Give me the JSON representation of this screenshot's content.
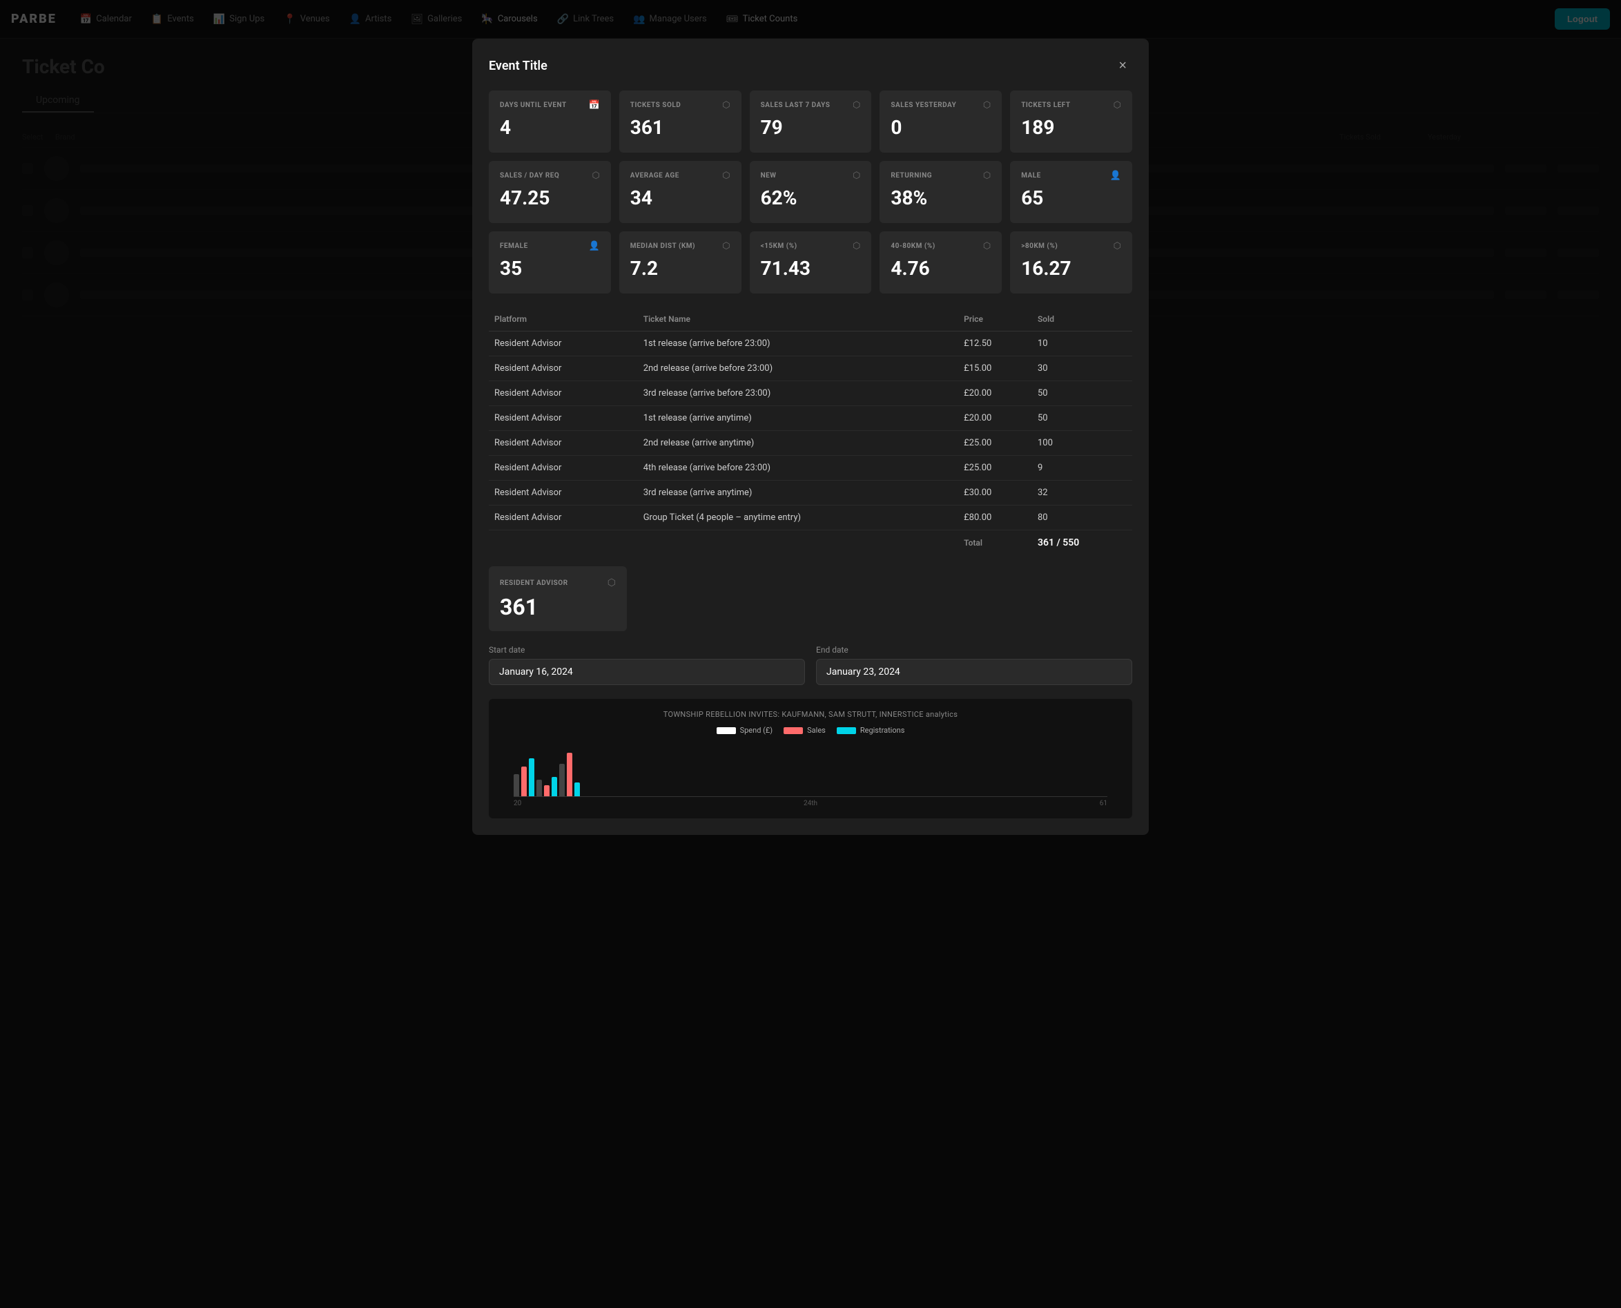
{
  "app": {
    "logo": "PARBE",
    "logout_label": "Logout"
  },
  "nav": {
    "items": [
      {
        "id": "calendar",
        "label": "Calendar",
        "icon": "📅"
      },
      {
        "id": "events",
        "label": "Events",
        "icon": "📋"
      },
      {
        "id": "signups",
        "label": "Sign Ups",
        "icon": "📊"
      },
      {
        "id": "venues",
        "label": "Venues",
        "icon": "📍"
      },
      {
        "id": "artists",
        "label": "Artists",
        "icon": "👤"
      },
      {
        "id": "galleries",
        "label": "Galleries",
        "icon": "🖼"
      },
      {
        "id": "carousels",
        "label": "Carousels",
        "icon": "🎠"
      },
      {
        "id": "linktrees",
        "label": "Link Trees",
        "icon": "🔗"
      },
      {
        "id": "manageusers",
        "label": "Manage Users",
        "icon": "👥"
      },
      {
        "id": "ticketcounts",
        "label": "Ticket Counts",
        "icon": "🎟"
      }
    ]
  },
  "page": {
    "title": "Ticket Co",
    "tabs": [
      {
        "id": "upcoming",
        "label": "Upcoming",
        "active": true
      }
    ],
    "table_columns": [
      "Select",
      "Brand",
      "Tickets Sold",
      "Yesterday"
    ]
  },
  "modal": {
    "title": "Event Title",
    "close_label": "×",
    "stats_row1": [
      {
        "id": "days_until",
        "label": "DAYS UNTIL EVENT",
        "value": "4",
        "icon": "📅"
      },
      {
        "id": "tickets_sold",
        "label": "TICKETS SOLD",
        "value": "361",
        "icon": "🎟"
      },
      {
        "id": "sales_last7",
        "label": "SALES LAST 7 DAYS",
        "value": "79",
        "icon": "🎟"
      },
      {
        "id": "sales_yesterday",
        "label": "SALES YESTERDAY",
        "value": "0",
        "icon": "🎟"
      },
      {
        "id": "tickets_left",
        "label": "TICKETS LEFT",
        "value": "189",
        "icon": "🎟"
      }
    ],
    "stats_row2": [
      {
        "id": "sales_day_req",
        "label": "SALES / DAY REQ",
        "value": "47.25",
        "icon": "🎟"
      },
      {
        "id": "avg_age",
        "label": "AVERAGE AGE",
        "value": "34",
        "icon": "🎟"
      },
      {
        "id": "new",
        "label": "NEW",
        "value": "62%",
        "icon": "🎟"
      },
      {
        "id": "returning",
        "label": "RETURNING",
        "value": "38%",
        "icon": "🎟"
      },
      {
        "id": "male",
        "label": "MALE",
        "value": "65",
        "icon": "👤"
      }
    ],
    "stats_row3": [
      {
        "id": "female",
        "label": "FEMALE",
        "value": "35",
        "icon": "👤"
      },
      {
        "id": "median_dist",
        "label": "MEDIAN DIST (KM)",
        "value": "7.2",
        "icon": "🎟"
      },
      {
        "id": "lt15km",
        "label": "<15KM (%)",
        "value": "71.43",
        "icon": "🎟"
      },
      {
        "id": "km40_80",
        "label": "40-80KM (%)",
        "value": "4.76",
        "icon": "🎟"
      },
      {
        "id": "gt80km",
        "label": ">80KM (%)",
        "value": "16.27",
        "icon": "🎟"
      }
    ],
    "table": {
      "columns": [
        "Platform",
        "Ticket Name",
        "Price",
        "Sold"
      ],
      "rows": [
        {
          "platform": "Resident Advisor",
          "ticket_name": "1st release (arrive before 23:00)",
          "price": "£12.50",
          "sold": "10"
        },
        {
          "platform": "Resident Advisor",
          "ticket_name": "2nd release (arrive before 23:00)",
          "price": "£15.00",
          "sold": "30"
        },
        {
          "platform": "Resident Advisor",
          "ticket_name": "3rd release (arrive before 23:00)",
          "price": "£20.00",
          "sold": "50"
        },
        {
          "platform": "Resident Advisor",
          "ticket_name": "1st release (arrive anytime)",
          "price": "£20.00",
          "sold": "50"
        },
        {
          "platform": "Resident Advisor",
          "ticket_name": "2nd release (arrive anytime)",
          "price": "£25.00",
          "sold": "100"
        },
        {
          "platform": "Resident Advisor",
          "ticket_name": "4th release (arrive before 23:00)",
          "price": "£25.00",
          "sold": "9"
        },
        {
          "platform": "Resident Advisor",
          "ticket_name": "3rd release (arrive anytime)",
          "price": "£30.00",
          "sold": "32"
        },
        {
          "platform": "Resident Advisor",
          "ticket_name": "Group Ticket (4 people – anytime entry)",
          "price": "£80.00",
          "sold": "80"
        }
      ],
      "total_label": "Total",
      "total_value": "361 / 550"
    },
    "ra_card": {
      "label": "RESIDENT ADVISOR",
      "value": "361",
      "icon": "🎟"
    },
    "date_section": {
      "start_label": "Start date",
      "start_value": "January 16, 2024",
      "end_label": "End date",
      "end_value": "January 23, 2024"
    },
    "chart": {
      "title": "TOWNSHIP REBELLION INVITES: KAUFMANN, SAM STRUTT, INNERSTICE analytics",
      "legend": [
        {
          "id": "spend",
          "label": "Spend (£)",
          "color": "#ffffff"
        },
        {
          "id": "sales",
          "label": "Sales",
          "color": "#ff6b6b"
        },
        {
          "id": "registrations",
          "label": "Registrations",
          "color": "#00d4e8"
        }
      ],
      "axis_labels": [
        "20",
        "24th"
      ],
      "axis_value": "61"
    }
  }
}
